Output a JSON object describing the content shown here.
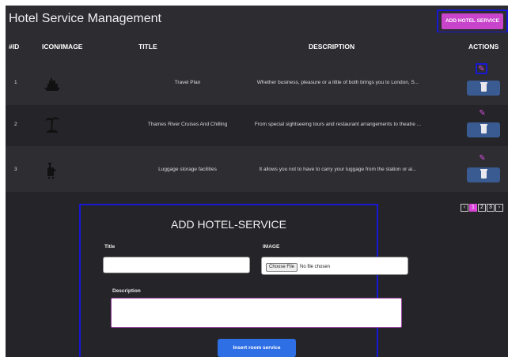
{
  "header": {
    "title": "Hotel Service Management",
    "add_button": "ADD HOTEL SERVICE"
  },
  "table": {
    "columns": [
      "#ID",
      "ICON/IMAGE",
      "TITLE",
      "DESCRIPTION",
      "ACTIONS"
    ],
    "rows": [
      {
        "id": "1",
        "icon": "ship-icon",
        "title": "Travel Plan",
        "description": "Whether business, pleasure or a little of both brings you to London, S..."
      },
      {
        "id": "2",
        "icon": "palm-tree-icon",
        "title": "Thames River Cruises And Chilling",
        "description": "From special sightseeing tours and restaurant arrangements to theatre ..."
      },
      {
        "id": "3",
        "icon": "luggage-icon",
        "title": "Luggage storage facilities",
        "description": "It allows you not to have to carry your luggage from the station or ai..."
      }
    ]
  },
  "pagination": {
    "prev": "‹",
    "pages": [
      "1",
      "2",
      "3"
    ],
    "active": "1",
    "next": "›"
  },
  "form": {
    "heading": "ADD HOTEL-SERVICE",
    "title_label": "Title",
    "title_value": "",
    "image_label": "IMAGE",
    "file_button": "Choose File",
    "file_status": "No file chosen",
    "description_label": "Description",
    "description_value": "",
    "submit": "Insert room service"
  },
  "colors": {
    "background": "#252529",
    "accent": "#c844ca",
    "delete_button": "#3a5a92",
    "submit_button": "#2f6fe6",
    "highlight_border": "#1717d6"
  }
}
